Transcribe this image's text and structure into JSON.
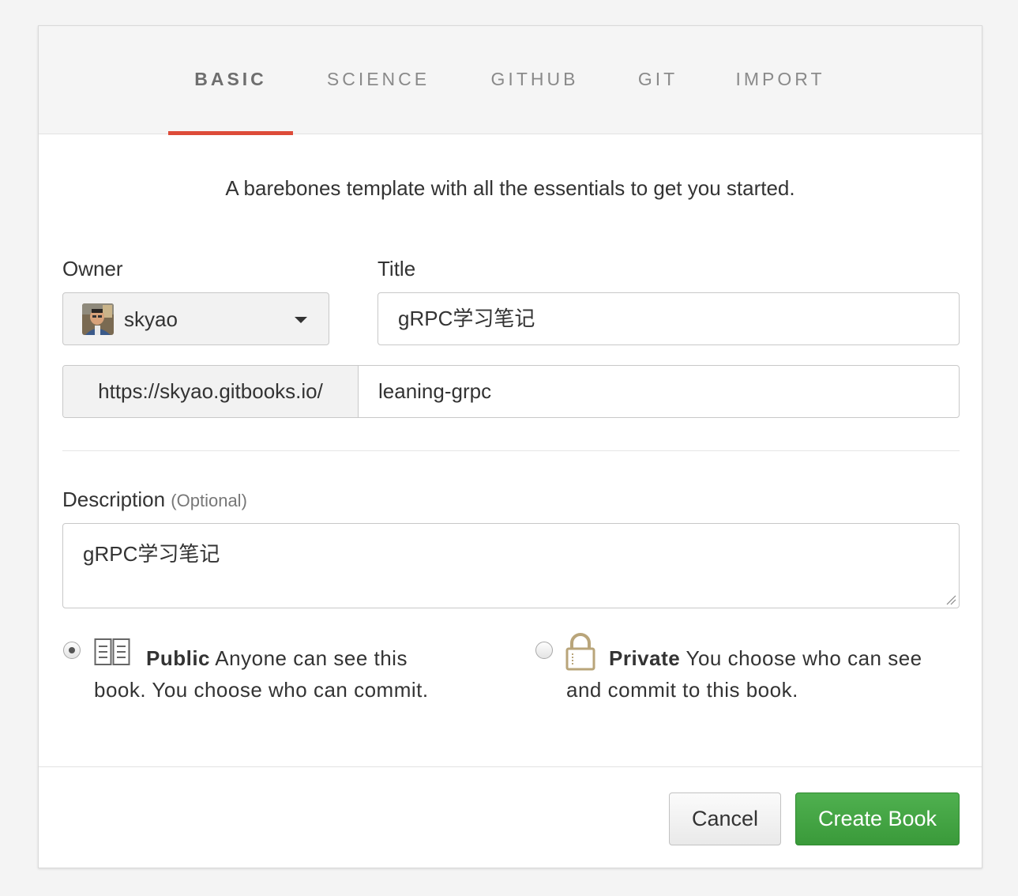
{
  "tabs": [
    {
      "label": "BASIC",
      "active": true
    },
    {
      "label": "SCIENCE",
      "active": false
    },
    {
      "label": "GITHUB",
      "active": false
    },
    {
      "label": "GIT",
      "active": false
    },
    {
      "label": "IMPORT",
      "active": false
    }
  ],
  "lead_text": "A barebones template with all the essentials to get you started.",
  "form": {
    "owner_label": "Owner",
    "owner_value": "skyao",
    "title_label": "Title",
    "title_value": "gRPC学习笔记",
    "url_prefix": "https://skyao.gitbooks.io/",
    "url_slug": "leaning-grpc",
    "description_label": "Description",
    "description_optional": "(Optional)",
    "description_value": "gRPC学习笔记"
  },
  "visibility": {
    "public": {
      "selected": true,
      "title": "Public",
      "text": " Anyone can see this book. You choose who can commit.",
      "icon": "book-icon"
    },
    "private": {
      "selected": false,
      "title": "Private",
      "text": " You choose who can see and commit to this book.",
      "icon": "lock-icon"
    }
  },
  "buttons": {
    "cancel": "Cancel",
    "create": "Create Book"
  },
  "colors": {
    "tab_active_underline": "#dd4b39",
    "create_button": "#3fa33f",
    "lock_icon": "#b9a57a"
  }
}
